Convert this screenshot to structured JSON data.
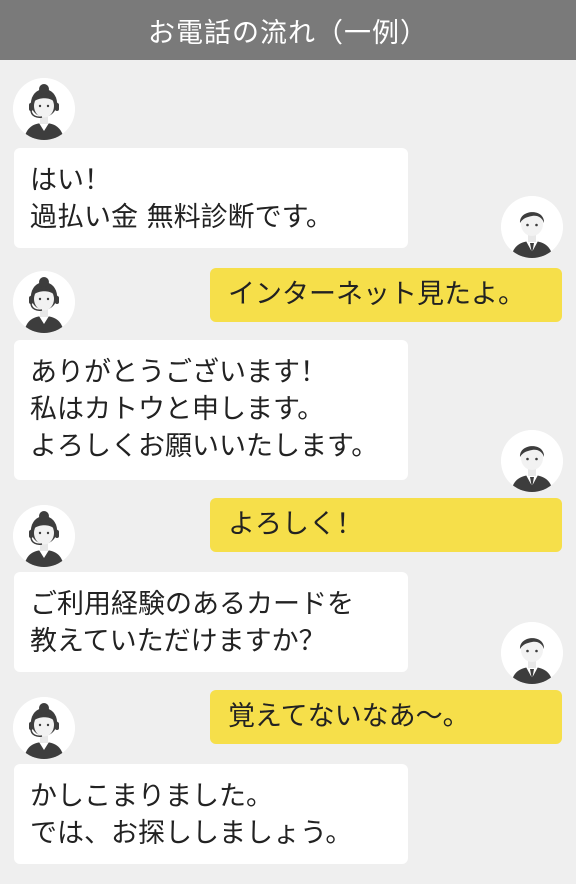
{
  "header": {
    "title": "お電話の流れ（一例）"
  },
  "icons": {
    "operator": "headset-operator-icon",
    "customer": "customer-man-icon"
  },
  "colors": {
    "header_bg": "#7a7a7a",
    "page_bg": "#efefef",
    "operator_bubble": "#ffffff",
    "customer_bubble": "#f6df4a"
  },
  "messages": [
    {
      "speaker": "operator",
      "lines": [
        "はい！",
        "過払い金 無料診断です。"
      ]
    },
    {
      "speaker": "customer",
      "lines": [
        "インターネット見たよ。"
      ]
    },
    {
      "speaker": "operator",
      "lines": [
        "ありがとうございます！",
        "私はカトウと申します。",
        "よろしくお願いいたします。"
      ]
    },
    {
      "speaker": "customer",
      "lines": [
        "よろしく！"
      ]
    },
    {
      "speaker": "operator",
      "lines": [
        "ご利用経験のあるカードを",
        "教えていただけますか？"
      ]
    },
    {
      "speaker": "customer",
      "lines": [
        "覚えてないなあ〜。"
      ]
    },
    {
      "speaker": "operator",
      "lines": [
        "かしこまりました。",
        "では、お探ししましょう。"
      ]
    }
  ]
}
